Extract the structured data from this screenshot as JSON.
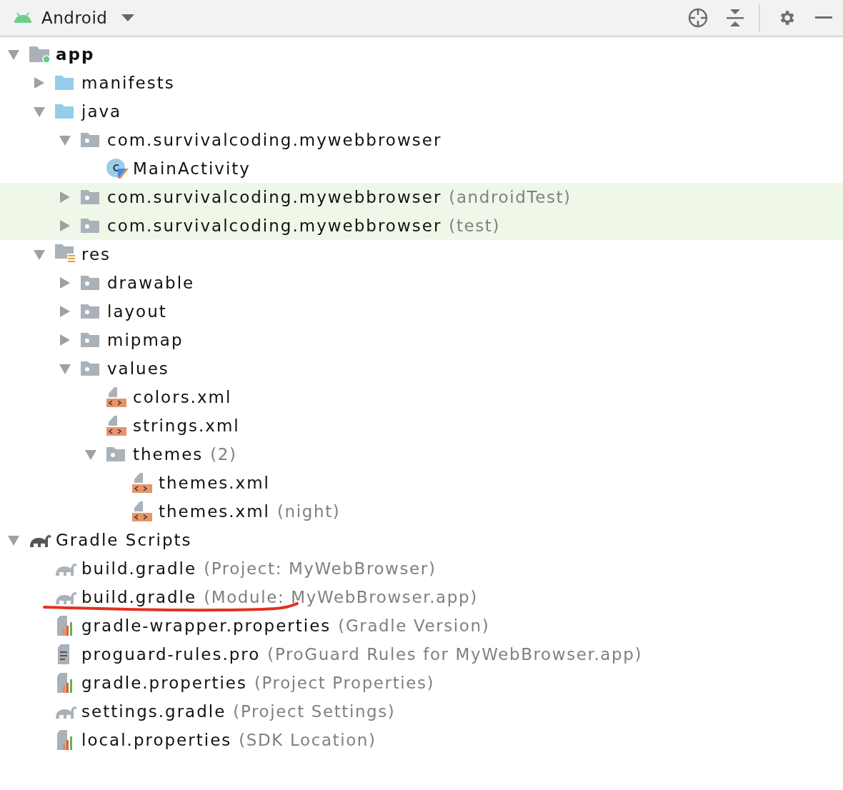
{
  "toolbar": {
    "view": "Android"
  },
  "tree": [
    {
      "label": "app",
      "kind": "module-folder",
      "bold": true,
      "expanded": true,
      "highlighted": false,
      "children": [
        {
          "label": "manifests",
          "kind": "source-folder",
          "expanded": false,
          "highlighted": false
        },
        {
          "label": "java",
          "kind": "source-folder",
          "expanded": true,
          "highlighted": false,
          "children": [
            {
              "label": "com.survivalcoding.mywebbrowser",
              "kind": "package",
              "expanded": true,
              "highlighted": false,
              "children": [
                {
                  "label": "MainActivity",
                  "kind": "kotlin-class",
                  "highlighted": false
                }
              ]
            },
            {
              "label": "com.survivalcoding.mywebbrowser",
              "hint": "(androidTest)",
              "kind": "package",
              "expanded": false,
              "highlighted": true
            },
            {
              "label": "com.survivalcoding.mywebbrowser",
              "hint": "(test)",
              "kind": "package",
              "expanded": false,
              "highlighted": true
            }
          ]
        },
        {
          "label": "res",
          "kind": "res-folder",
          "expanded": true,
          "highlighted": false,
          "children": [
            {
              "label": "drawable",
              "kind": "package",
              "expanded": false,
              "highlighted": false
            },
            {
              "label": "layout",
              "kind": "package",
              "expanded": false,
              "highlighted": false
            },
            {
              "label": "mipmap",
              "kind": "package",
              "expanded": false,
              "highlighted": false
            },
            {
              "label": "values",
              "kind": "package",
              "expanded": true,
              "highlighted": false,
              "children": [
                {
                  "label": "colors.xml",
                  "kind": "xml",
                  "highlighted": false
                },
                {
                  "label": "strings.xml",
                  "kind": "xml",
                  "highlighted": false
                },
                {
                  "label": "themes",
                  "hint": "(2)",
                  "kind": "package",
                  "expanded": true,
                  "highlighted": false,
                  "children": [
                    {
                      "label": "themes.xml",
                      "kind": "xml",
                      "highlighted": false
                    },
                    {
                      "label": "themes.xml",
                      "hint": "(night)",
                      "kind": "xml",
                      "highlighted": false
                    }
                  ]
                }
              ]
            }
          ]
        }
      ]
    },
    {
      "label": "Gradle Scripts",
      "kind": "gradle-group",
      "expanded": true,
      "highlighted": false,
      "children": [
        {
          "label": "build.gradle",
          "hint": "(Project: MyWebBrowser)",
          "kind": "gradle",
          "highlighted": false
        },
        {
          "label": "build.gradle",
          "hint": "(Module: MyWebBrowser.app)",
          "kind": "gradle",
          "highlighted": false,
          "underlined": true
        },
        {
          "label": "gradle-wrapper.properties",
          "hint": "(Gradle Version)",
          "kind": "properties",
          "highlighted": false
        },
        {
          "label": "proguard-rules.pro",
          "hint": "(ProGuard Rules for MyWebBrowser.app)",
          "kind": "text-file",
          "highlighted": false
        },
        {
          "label": "gradle.properties",
          "hint": "(Project Properties)",
          "kind": "properties",
          "highlighted": false
        },
        {
          "label": "settings.gradle",
          "hint": "(Project Settings)",
          "kind": "gradle",
          "highlighted": false
        },
        {
          "label": "local.properties",
          "hint": "(SDK Location)",
          "kind": "properties",
          "highlighted": false
        }
      ]
    }
  ]
}
